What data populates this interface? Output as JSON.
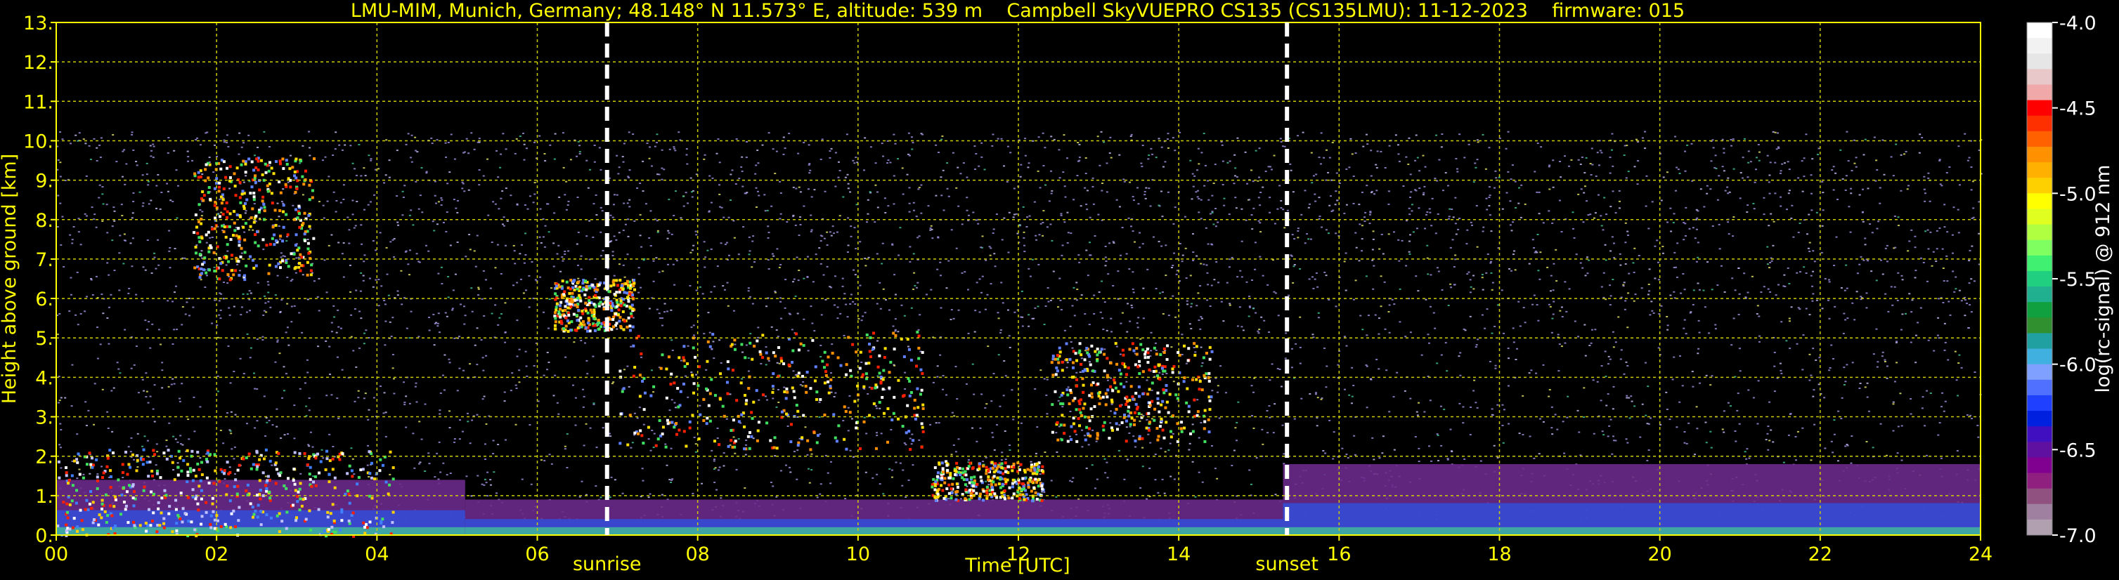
{
  "chart_data": {
    "type": "heatmap",
    "title": "LMU-MIM, Munich, Germany; 48.148° N 11.573° E, altitude: 539 m    Campbell SkyVUEPRO CS135 (CS135LMU): 11-12-2023    firmware: 015",
    "xlabel": "Time [UTC]",
    "ylabel": "Height above ground [km]",
    "xlim": [
      0,
      24
    ],
    "ylim": [
      0,
      13
    ],
    "x_ticks": [
      "00",
      "02",
      "04",
      "06",
      "08",
      "10",
      "12",
      "14",
      "16",
      "18",
      "20",
      "22",
      "24"
    ],
    "y_ticks": [
      "0.",
      "1.",
      "2.",
      "3.",
      "4.",
      "5.",
      "6.",
      "7.",
      "8.",
      "9.",
      "10.",
      "11.",
      "12.",
      "13."
    ],
    "grid": true,
    "markers": [
      {
        "label": "sunrise",
        "x": 6.87
      },
      {
        "label": "sunset",
        "x": 15.35
      }
    ],
    "colorbar": {
      "label": "log(rc-signal) @ 912 nm",
      "range": [
        -7.0,
        -4.0
      ],
      "ticks": [
        "-4.0",
        "-4.5",
        "-5.0",
        "-5.5",
        "-6.0",
        "-6.5",
        "-7.0"
      ],
      "colors": [
        "#ffffff",
        "#f2f2f2",
        "#e6e6e6",
        "#e8c8c8",
        "#f0a8a8",
        "#ff0000",
        "#ff3000",
        "#ff6000",
        "#ff9000",
        "#ffb000",
        "#ffd000",
        "#ffff00",
        "#e0ff20",
        "#b0ff40",
        "#80ff60",
        "#40f070",
        "#20d080",
        "#20b090",
        "#10a040",
        "#309030",
        "#20a0a0",
        "#40b0e0",
        "#80a0ff",
        "#5070ff",
        "#2040ff",
        "#0020e0",
        "#4010c0",
        "#6010a0",
        "#800090",
        "#902080",
        "#905080",
        "#a080a0",
        "#b0a0b0"
      ]
    },
    "colors": {
      "background": "#000000",
      "text": "#ffff00",
      "grid": "#cccc00",
      "marker": "#ffffff",
      "noise": "#9a8cd8"
    },
    "features": [
      {
        "kind": "noise_band",
        "x0": 0.0,
        "x1": 24.0,
        "y0": 5.5,
        "y1": 10.25
      },
      {
        "kind": "noise_band",
        "x0": 0.0,
        "x1": 24.0,
        "y0": 0.4,
        "y1": 5.5
      },
      {
        "kind": "boundary_layer",
        "x0": 0.0,
        "x1": 5.1,
        "y0": 0.0,
        "y1": 1.4
      },
      {
        "kind": "boundary_layer",
        "x0": 5.1,
        "x1": 15.3,
        "y0": 0.0,
        "y1": 0.9
      },
      {
        "kind": "boundary_layer",
        "x0": 15.3,
        "x1": 24.0,
        "y0": 0.0,
        "y1": 1.8
      },
      {
        "kind": "cloud",
        "x0": 1.7,
        "x1": 3.2,
        "y0": 6.5,
        "y1": 9.6
      },
      {
        "kind": "cloud",
        "x0": 6.2,
        "x1": 7.2,
        "y0": 5.2,
        "y1": 6.5
      },
      {
        "kind": "cloud",
        "x0": 7.0,
        "x1": 10.8,
        "y0": 2.2,
        "y1": 5.2
      },
      {
        "kind": "cloud",
        "x0": 12.4,
        "x1": 14.4,
        "y0": 2.4,
        "y1": 4.9
      },
      {
        "kind": "cloud",
        "x0": 10.9,
        "x1": 12.3,
        "y0": 0.9,
        "y1": 1.9
      },
      {
        "kind": "low_cloud",
        "x0": 0.0,
        "x1": 4.2,
        "y0": 0.0,
        "y1": 2.2
      }
    ]
  }
}
